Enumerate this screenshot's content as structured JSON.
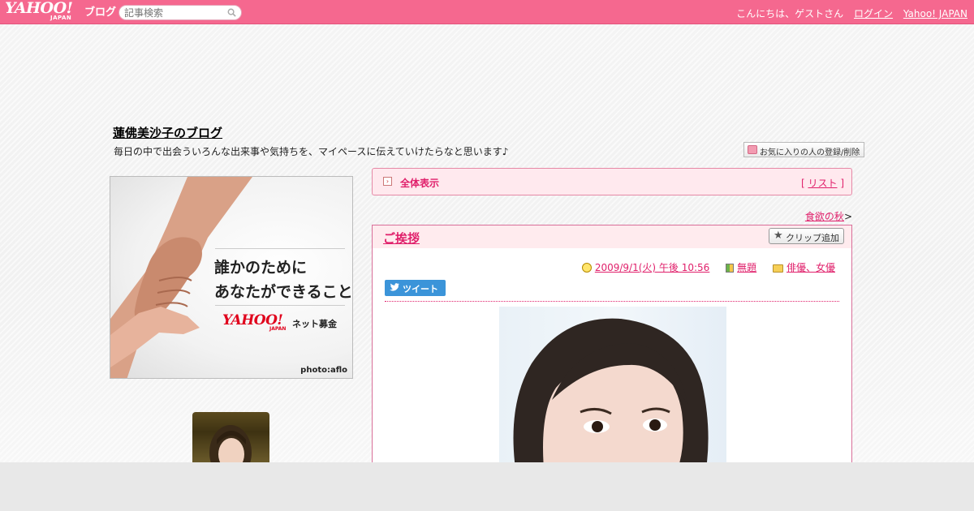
{
  "header": {
    "logo_main": "YAHOO!",
    "logo_sub": "JAPAN",
    "logo_blog": "ブログ",
    "search_placeholder": "記事検索",
    "greeting": "こんにちは、ゲストさん",
    "login": "ログイン",
    "yahoo_japan": "Yahoo! JAPAN"
  },
  "blog": {
    "title": "蓮佛美沙子のブログ",
    "description": "毎日の中で出会ういろんな出来事や気持ちを、マイペースに伝えていけたらなと思います♪",
    "favorite_button": "お気に入りの人の登録/削除"
  },
  "banner": {
    "line1": "誰かのために",
    "line2": "あなたができること",
    "yahoo": "YAHOO!",
    "yahoo_sub": "JAPAN",
    "service": "ネット募金",
    "credit": "photo:aflo"
  },
  "nav": {
    "all": "全体表示",
    "list_open": "[ ",
    "list": "リスト",
    "list_close": " ]",
    "next_article": "食欲の秋",
    "next_arrow": ">"
  },
  "article": {
    "title": "ご挨拶",
    "clip_button": "クリップ追加",
    "datetime": "2009/9/1(火) 午後 10:56",
    "theme": "無題",
    "category": "俳優、女優",
    "tweet": "ツイート"
  },
  "colors": {
    "topbar": "#f5688f",
    "accent": "#e0206b",
    "nav_bg": "#ffe9ee"
  }
}
